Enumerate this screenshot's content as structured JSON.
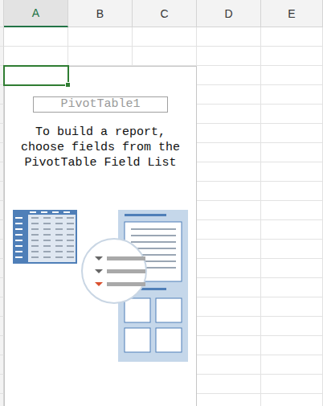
{
  "sheet": {
    "columns": [
      {
        "label": "A",
        "selected": true
      },
      {
        "label": "B",
        "selected": false
      },
      {
        "label": "C",
        "selected": false
      },
      {
        "label": "D",
        "selected": false
      },
      {
        "label": "E",
        "selected": false
      }
    ]
  },
  "pivot_table": {
    "name": "PivotTable1",
    "instructions": "To build a report, choose fields from the PivotTable Field List"
  }
}
